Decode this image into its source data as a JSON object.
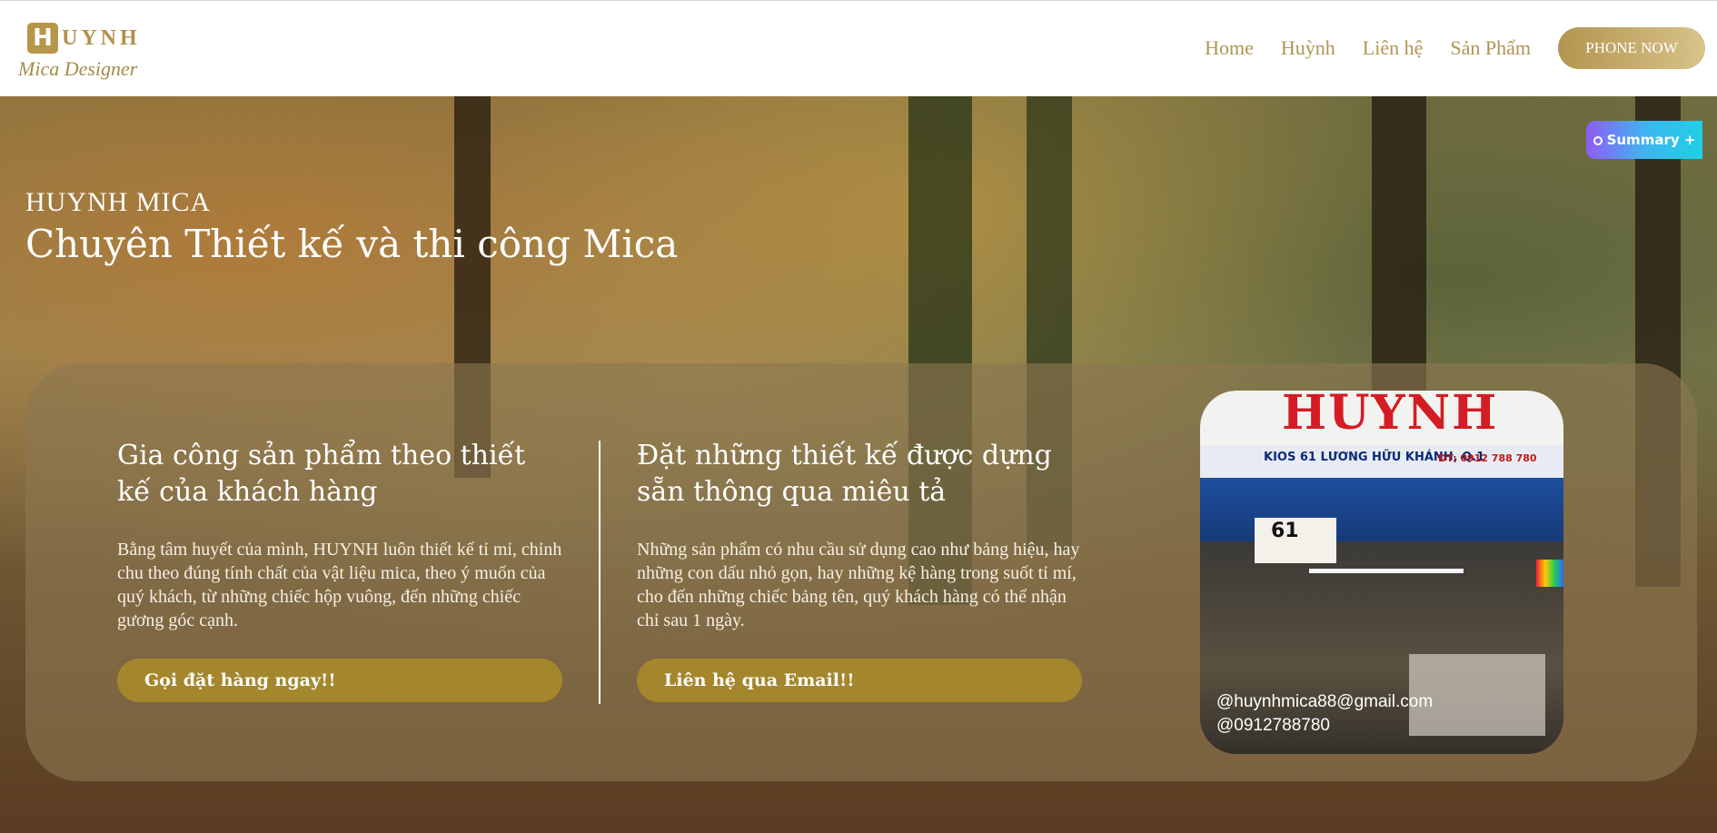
{
  "header": {
    "logo_letter": "H",
    "logo_word": "UYNH",
    "logo_tagline": "Mica Designer",
    "nav": [
      "Home",
      "Huỳnh",
      "Liên hệ",
      "Sản Phẩm"
    ],
    "phone_button": "PHONE NOW"
  },
  "summary_widget": {
    "label": "Summary +"
  },
  "hero": {
    "kicker": "HUYNH MICA",
    "title": "Chuyên Thiết kế và thi công Mica"
  },
  "features": [
    {
      "title": "Gia công sản phẩm theo thiết kế của khách hàng",
      "body": "Bằng tâm huyết của mình, HUYNH luôn thiết kế tỉ mỉ, chỉnh chu theo đúng tính chất của vật liệu mica, theo ý muốn của quý khách, từ những chiếc hộp vuông, đến những chiếc gương góc cạnh.",
      "button": "Gọi đặt hàng ngay!!"
    },
    {
      "title": "Đặt những thiết kế được dựng sẵn thông qua miêu tả",
      "body": "Những sản phẩm có nhu cầu sử dụng cao như bảng hiệu, hay những con dấu nhỏ gọn, hay những kệ hàng trong suốt tỉ mí, cho đến những chiếc bảng tên, quý khách hàng có thể nhận chỉ sau 1 ngày.",
      "button": "Liên hệ qua Email!!"
    }
  ],
  "shop_photo": {
    "sign_name": "HUYNH",
    "sign_address": "KIOS 61 LƯƠNG HỮU KHÁNH, Q.1",
    "sign_phone": "ĐT: 0912 788 780",
    "kiosk_number": "61",
    "email": "@huynhmica88@gmail.com",
    "phone": "@0912788780"
  },
  "colors": {
    "accent": "#b1914a",
    "button": "#aa8c28"
  }
}
